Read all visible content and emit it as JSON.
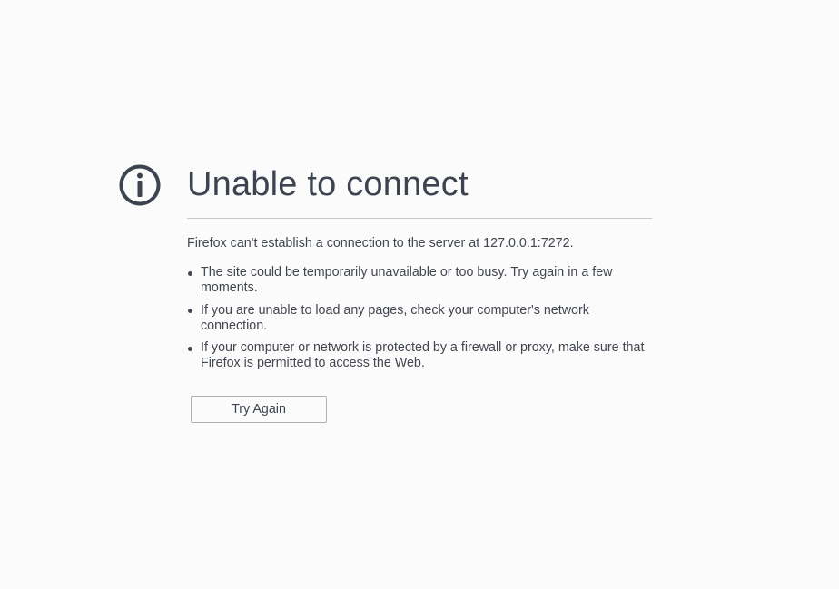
{
  "error_page": {
    "title": "Unable to connect",
    "message": "Firefox can't establish a connection to the server at 127.0.0.1:7272.",
    "reasons": [
      "The site could be temporarily unavailable or too busy. Try again in a few moments.",
      "If you are unable to load any pages, check your computer's network connection.",
      "If your computer or network is protected by a firewall or proxy, make sure that Firefox is permitted to access the Web."
    ],
    "button_label": "Try Again",
    "icon": "info-icon"
  },
  "colors": {
    "background": "#fbfbfb",
    "text": "#42464f",
    "icon": "#3e4350",
    "divider": "#c8c9cc",
    "button_border": "#b1b1b3"
  }
}
